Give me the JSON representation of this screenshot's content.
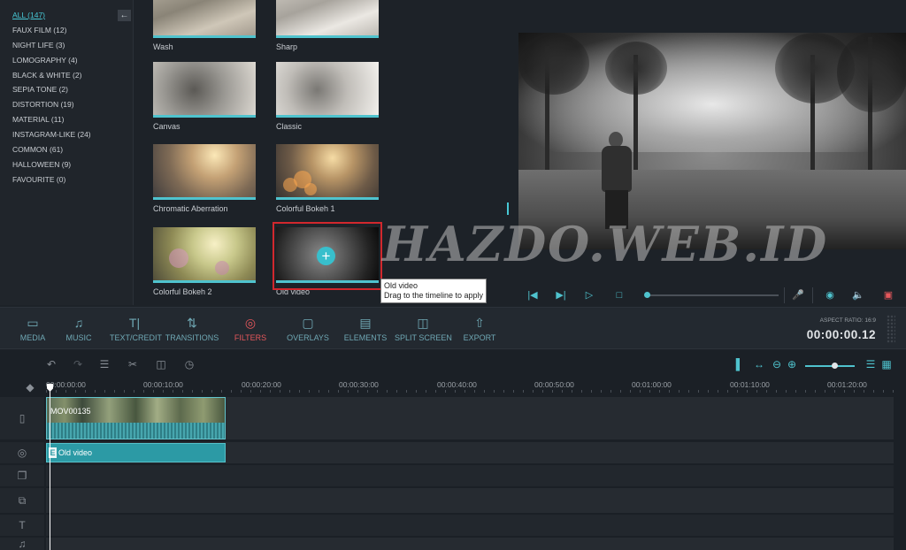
{
  "categories": [
    {
      "label": "ALL (147)",
      "active": true
    },
    {
      "label": "FAUX FILM (12)"
    },
    {
      "label": "NIGHT LIFE (3)"
    },
    {
      "label": "LOMOGRAPHY (4)"
    },
    {
      "label": "BLACK & WHITE (2)"
    },
    {
      "label": "SEPIA TONE (2)"
    },
    {
      "label": "DISTORTION (19)"
    },
    {
      "label": "MATERIAL (11)"
    },
    {
      "label": "INSTAGRAM-LIKE (24)"
    },
    {
      "label": "COMMON (61)"
    },
    {
      "label": "HALLOWEEN (9)"
    },
    {
      "label": "FAVOURITE (0)"
    }
  ],
  "filters": [
    {
      "name": "Wash"
    },
    {
      "name": "Sharp"
    },
    {
      "name": "Canvas"
    },
    {
      "name": "Classic"
    },
    {
      "name": "Chromatic Aberration"
    },
    {
      "name": "Colorful Bokeh 1"
    },
    {
      "name": "Colorful Bokeh 2"
    },
    {
      "name": "Old video",
      "selected": true
    }
  ],
  "tooltip": {
    "line1": "Old video",
    "line2": "Drag to the timeline to apply"
  },
  "watermark": "HAZDO.WEB.ID",
  "toolbar": {
    "media": "MEDIA",
    "music": "MUSIC",
    "text": "TEXT/CREDIT",
    "transitions": "TRANSITIONS",
    "filters": "FILTERS",
    "overlays": "OVERLAYS",
    "elements": "ELEMENTS",
    "split": "SPLIT SCREEN",
    "export": "EXPORT",
    "aspect_ratio": "ASPECT RATIO: 16:9",
    "timecode": "00:00:00.12"
  },
  "ruler": [
    "00:00:00:00",
    "00:00:10:00",
    "00:00:20:00",
    "00:00:30:00",
    "00:00:40:00",
    "00:00:50:00",
    "00:01:00:00",
    "00:01:10:00",
    "00:01:20:00"
  ],
  "timeline": {
    "video_clip": "MOV00135",
    "filter_clip": "Old video",
    "filter_badge": "E"
  },
  "colors": {
    "accent": "#4fc3ce",
    "active_tool": "#e5575b",
    "selection": "#d1282d"
  }
}
